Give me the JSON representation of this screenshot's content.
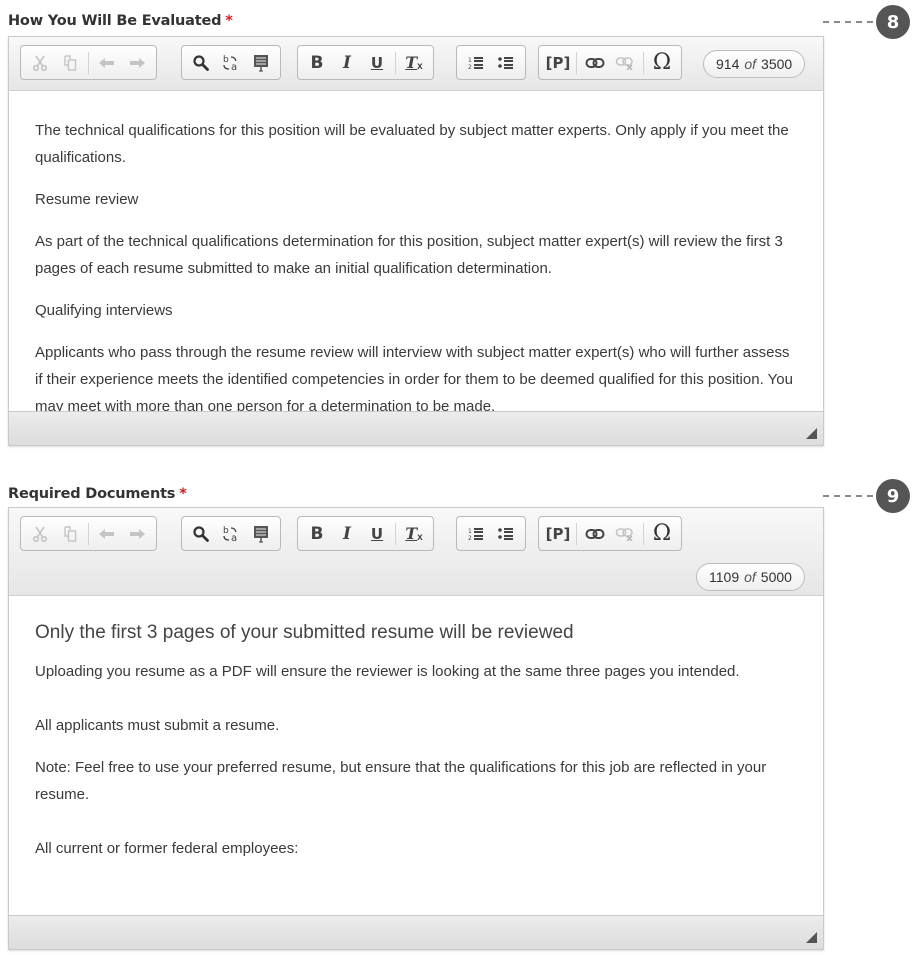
{
  "colors": {
    "required": "#cc1f1f",
    "badge": "#555555"
  },
  "toolbar": {
    "icons": {
      "cut": "scissors-icon",
      "copy": "copy-icon",
      "undo": "undo-icon",
      "redo": "redo-icon",
      "find": "search-icon",
      "replace": "replace-icon",
      "select_all": "select-all-icon",
      "bold": "B",
      "italic": "I",
      "underline": "U",
      "remove_format": "T",
      "numbered_list": "numbered-list-icon",
      "bulleted_list": "bulleted-list-icon",
      "paragraph": "[P]",
      "link": "link-icon",
      "unlink": "unlink-icon",
      "special_char": "Ω"
    },
    "counter_of": "of"
  },
  "fields": [
    {
      "label": "How You Will Be Evaluated",
      "required_mark": "*",
      "callout": "8",
      "counter": {
        "current": "914",
        "max": "3500"
      },
      "paragraphs": [
        "The technical qualifications for this position will be evaluated by subject matter experts. Only apply if you meet the qualifications.",
        "Resume review",
        "As part of the technical qualifications determination for this position, subject matter expert(s) will review the first 3 pages of each resume submitted to make an initial qualification determination.",
        "Qualifying interviews",
        "Applicants who pass through the resume review will interview with subject matter expert(s) who will further assess if their experience meets the identified competencies in order for them to be deemed qualified for this position. You may meet with more than one person for a determination to be made."
      ]
    },
    {
      "label": "Required Documents",
      "required_mark": "*",
      "callout": "9",
      "counter": {
        "current": "1109",
        "max": "5000"
      },
      "heading": "Only the first 3 pages of your submitted resume will be reviewed",
      "paragraphs": [
        "Uploading you resume as a PDF will ensure the reviewer is looking at the same three pages you intended.",
        "All applicants must submit a resume.",
        "Note: Feel free to use your preferred resume, but ensure that the qualifications for this job are reflected in your resume.",
        "All current or former federal employees:"
      ]
    }
  ]
}
